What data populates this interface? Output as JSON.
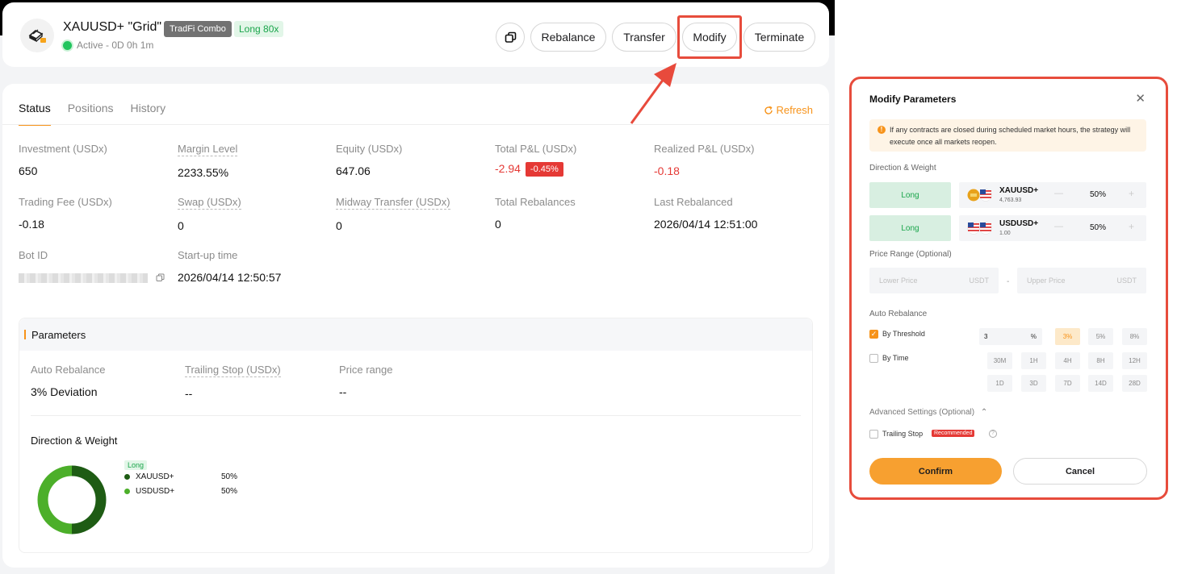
{
  "colors": {
    "accent": "#f7931a",
    "success": "#22c55e",
    "danger": "#e53935",
    "highlight": "#e74c3c",
    "donut_dark": "#1e5c14",
    "donut_light": "#4caf2a"
  },
  "header": {
    "bot_icon": "gold-bars-icon",
    "title": "XAUUSD+ \"Grid\"",
    "tag_type": "TradFi Combo",
    "tag_leverage": "Long 80x",
    "status": "Active - 0D 0h 1m",
    "buttons": {
      "rebalance": "Rebalance",
      "transfer": "Transfer",
      "modify": "Modify",
      "terminate": "Terminate"
    }
  },
  "tabs": [
    {
      "label": "Status"
    },
    {
      "label": "Positions"
    },
    {
      "label": "History"
    }
  ],
  "refresh_label": "Refresh",
  "stats": [
    {
      "label": "Investment (USDx)",
      "value": "650"
    },
    {
      "label": "Margin Level",
      "value": "2233.55%"
    },
    {
      "label": "Equity (USDx)",
      "value": "647.06"
    },
    {
      "label": "Total P&L (USDx)",
      "value": "-2.94",
      "badge": "-0.45%"
    },
    {
      "label": "Realized P&L (USDx)",
      "value": "-0.18"
    },
    {
      "label": "Trading Fee (USDx)",
      "value": "-0.18"
    },
    {
      "label": "Swap (USDx)",
      "value": "0"
    },
    {
      "label": "Midway Transfer (USDx)",
      "value": "0"
    },
    {
      "label": "Total Rebalances",
      "value": "0"
    },
    {
      "label": "Last Rebalanced",
      "value": "2026/04/14 12:51:00"
    },
    {
      "label": "Bot ID",
      "value": ""
    },
    {
      "label": "Start-up time",
      "value": "2026/04/14 12:50:57"
    }
  ],
  "parameters": {
    "title": "Parameters",
    "auto_rebalance_label": "Auto Rebalance",
    "auto_rebalance_value": "3% Deviation",
    "trailing_stop_label": "Trailing Stop (USDx)",
    "trailing_stop_value": "--",
    "price_range_label": "Price range",
    "price_range_value": "--",
    "direction_weight_title": "Direction & Weight",
    "legend_tag": "Long",
    "assets": [
      {
        "name": "XAUUSD+",
        "pct": "50%",
        "weight": 0.5
      },
      {
        "name": "USDUSD+",
        "pct": "50%",
        "weight": 0.5
      }
    ]
  },
  "modal": {
    "title": "Modify Parameters",
    "notice": "If any contracts are closed during scheduled market hours, the strategy will execute once all markets reopen.",
    "direction_weight_label": "Direction & Weight",
    "rows": [
      {
        "direction": "Long",
        "asset": "XAUUSD+",
        "price": "4,763.93",
        "pct": "50%"
      },
      {
        "direction": "Long",
        "asset": "USDUSD+",
        "price": "1.00",
        "pct": "50%"
      }
    ],
    "minus": "—",
    "plus": "+",
    "price_range_label": "Price Range (Optional)",
    "lower_placeholder": "Lower Price",
    "upper_placeholder": "Upper Price",
    "unit": "USDT",
    "range_sep": "-",
    "auto_rebalance_label": "Auto Rebalance",
    "by_threshold_label": "By Threshold",
    "by_threshold_checked": true,
    "threshold_value": "3",
    "threshold_unit": "%",
    "threshold_options": [
      "3%",
      "5%",
      "8%"
    ],
    "threshold_selected": "3%",
    "by_time_label": "By Time",
    "by_time_checked": false,
    "time_options_row1": [
      "30M",
      "1H",
      "4H",
      "8H",
      "12H"
    ],
    "time_options_row2": [
      "1D",
      "3D",
      "7D",
      "14D",
      "28D"
    ],
    "advanced_label": "Advanced Settings (Optional)",
    "trailing_stop_label": "Trailing Stop",
    "recommended": "Recommended",
    "confirm": "Confirm",
    "cancel": "Cancel",
    "close_icon": "close-icon"
  }
}
